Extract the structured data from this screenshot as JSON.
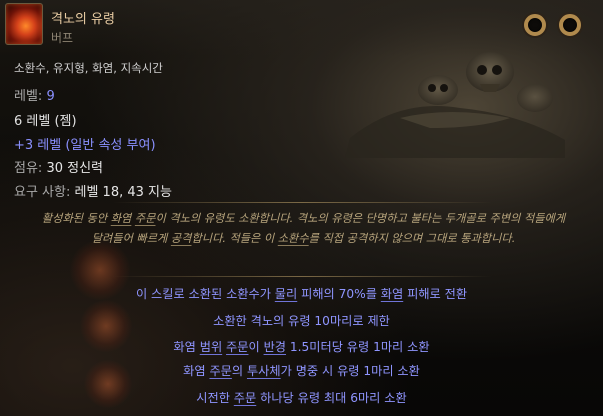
{
  "skill": {
    "name": "격노의 유령",
    "type": "버프"
  },
  "tags": "소환수, 유지형, 화염, 지속시간",
  "level": {
    "label": "레벨: ",
    "value": "9"
  },
  "gem_level": "6 레벨 (젬)",
  "bonus_level": "+3 레벨 (일반 속성 부여)",
  "reservation": {
    "label": "점유: ",
    "value": "30 정신력"
  },
  "requirement": {
    "label": "요구 사항: ",
    "value": "레벨 18, 43 지능"
  },
  "description": {
    "part1": "활성화된 동안 ",
    "kw1": "화염",
    "part2": " ",
    "kw2": "주문",
    "part3": "이 격노의 유령도 소환합니다. 격노의 유령은 단명하고 불타는 두개골로 주변의 적들에게 달려들어 빠르게 ",
    "kw3": "공격",
    "part4": "합니다. 적들은 이 ",
    "kw4": "소환수",
    "part5": "를 직접 공격하지 않으며 그대로 통과합니다."
  },
  "modifiers": {
    "m1_a": "이 스킬로 소환된 소환수가 ",
    "m1_kw1": "물리",
    "m1_b": " 피해의 70%를 ",
    "m1_kw2": "화염",
    "m1_c": " 피해로 전환",
    "m2": "소환한 격노의 유령 10마리로 제한",
    "m3_a": "화염 ",
    "m3_kw1": "범위",
    "m3_b": " ",
    "m3_kw2": "주문",
    "m3_c": "이 ",
    "m3_kw3": "반경",
    "m3_d": " 1.5미터당 유령 1마리 소환",
    "m4_a": "화염 ",
    "m4_kw1": "주문",
    "m4_b": "의 ",
    "m4_kw2": "투사체",
    "m4_c": "가 명중 시 유령 1마리 소환",
    "m5_a": "시전한 ",
    "m5_kw1": "주문",
    "m5_b": " 하나당 유령 최대 6마리 소환"
  },
  "colors": {
    "name": "#e8cba3",
    "magic_blue": "#8f95ff",
    "description": "#b8a57d",
    "ring": "#b08a4d"
  },
  "icons": {
    "skill": "flaming-skull-icon",
    "ring_left": "socket-ring-icon",
    "ring_right": "socket-ring-icon"
  }
}
